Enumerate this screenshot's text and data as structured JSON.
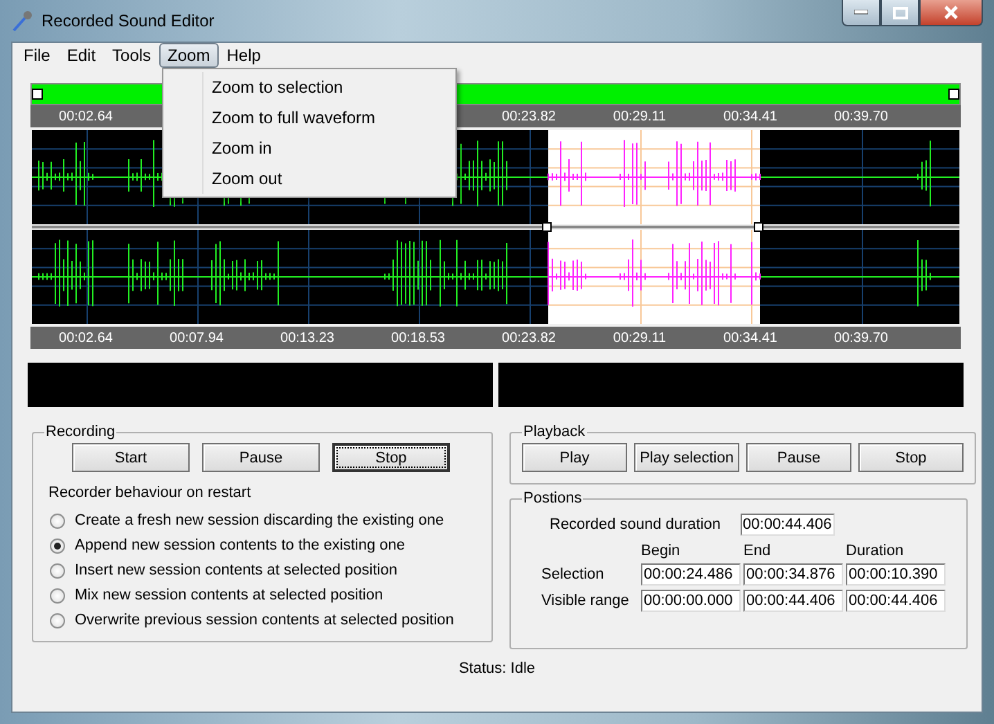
{
  "window": {
    "title": "Recorded Sound Editor"
  },
  "menu": [
    {
      "label": "File",
      "selected": false
    },
    {
      "label": "Edit",
      "selected": false
    },
    {
      "label": "Tools",
      "selected": false
    },
    {
      "label": "Zoom",
      "selected": true
    },
    {
      "label": "Help",
      "selected": false
    }
  ],
  "zoom_menu": [
    "Zoom to selection",
    "Zoom to full waveform",
    "Zoom in",
    "Zoom out"
  ],
  "top_ruler": [
    "00:02.64",
    "00:23.82",
    "00:29.11",
    "00:34.41",
    "00:39.70"
  ],
  "bottom_ruler": [
    "00:02.64",
    "00:07.94",
    "00:13.23",
    "00:18.53",
    "00:23.82",
    "00:29.11",
    "00:34.41",
    "00:39.70"
  ],
  "recording": {
    "title": "Recording",
    "buttons": [
      {
        "label": "Start",
        "focused": false
      },
      {
        "label": "Pause",
        "focused": false
      },
      {
        "label": "Stop",
        "focused": true
      }
    ],
    "options_label": "Recorder behaviour on restart",
    "options": [
      {
        "label": "Create a fresh new session discarding the existing one",
        "selected": false
      },
      {
        "label": "Append new session contents to the existing one",
        "selected": true
      },
      {
        "label": "Insert new session contents at selected position",
        "selected": false
      },
      {
        "label": "Mix new session contents at selected position",
        "selected": false
      },
      {
        "label": "Overwrite previous session contents at selected position",
        "selected": false
      }
    ]
  },
  "playback": {
    "title": "Playback",
    "buttons": [
      "Play",
      "Play selection",
      "Pause",
      "Stop"
    ]
  },
  "positions": {
    "title": "Postions",
    "duration_label": "Recorded sound duration",
    "duration": "00:00:44.406",
    "columns": [
      "Begin",
      "End",
      "Duration"
    ],
    "rows": [
      {
        "label": "Selection",
        "values": [
          "00:00:24.486",
          "00:00:34.876",
          "00:00:10.390"
        ]
      },
      {
        "label": "Visible range",
        "values": [
          "00:00:00.000",
          "00:00:44.406",
          "00:00:44.406"
        ]
      }
    ]
  },
  "status": "Status: Idle"
}
